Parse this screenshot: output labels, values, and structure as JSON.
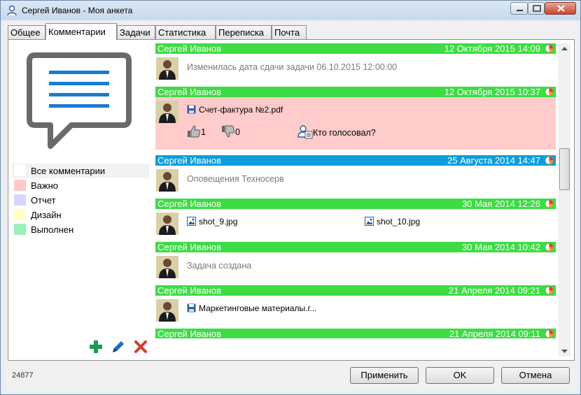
{
  "window": {
    "title": "Сергей Иванов - Моя анкета"
  },
  "tabs": [
    {
      "label": "Общее"
    },
    {
      "label": "Комментарии"
    },
    {
      "label": "Задачи"
    },
    {
      "label": "Статистика"
    },
    {
      "label": "Переписка"
    },
    {
      "label": "Почта"
    }
  ],
  "active_tab": "Комментарии",
  "filters": [
    {
      "label": "Все комментарии",
      "color": "#ffffff"
    },
    {
      "label": "Важно",
      "color": "#ffc9c9"
    },
    {
      "label": "Отчет",
      "color": "#d6d6ff"
    },
    {
      "label": "Дизайн",
      "color": "#ffffc4"
    },
    {
      "label": "Выполнен",
      "color": "#9cf0b8"
    }
  ],
  "colors": {
    "green": "#3ddc43",
    "blue": "#0d9ddb",
    "important_bg": "#ffcbcb"
  },
  "comments": [
    {
      "author": "Сергей Иванов",
      "date": "12 Октября 2015 14:09",
      "header_color": "#3ddc43",
      "bg": "#ffffff",
      "text": "Изменилась дата сдачи задачи 06.10.2015 12:00:00",
      "files": []
    },
    {
      "author": "Сергей Иванов",
      "date": "12 Октября 2015 10:37",
      "header_color": "#3ddc43",
      "bg": "#ffcbcb",
      "text": "",
      "files": [
        {
          "name": "Счет-фактура №2.pdf",
          "icon": "floppy-icon"
        }
      ],
      "likes": "1",
      "dislikes": "0",
      "who_voted": "Кто голосовал?"
    },
    {
      "author": "Сергей Иванов",
      "date": "25 Августа 2014 14:47",
      "header_color": "#0d9ddb",
      "bg": "#ffffff",
      "text": "Оповещения Техносерв",
      "files": []
    },
    {
      "author": "Сергей Иванов",
      "date": "30 Мая 2014 12:26",
      "header_color": "#3ddc43",
      "bg": "#ffffff",
      "text": "",
      "files": [
        {
          "name": "shot_9.jpg",
          "icon": "image-icon"
        },
        {
          "name": "shot_10.jpg",
          "icon": "image-icon"
        }
      ]
    },
    {
      "author": "Сергей Иванов",
      "date": "30 Мая 2014 10:42",
      "header_color": "#3ddc43",
      "bg": "#ffffff",
      "text": "Задача создана",
      "files": []
    },
    {
      "author": "Сергей Иванов",
      "date": "21 Апреля 2014 09:21",
      "header_color": "#3ddc43",
      "bg": "#ffffff",
      "text": "",
      "files": [
        {
          "name": "Маркетинговые материалы.г...",
          "icon": "floppy-icon"
        }
      ]
    },
    {
      "author": "Сергей Иванов",
      "date": "21 Апреля 2014 09:11",
      "header_color": "#3ddc43",
      "bg": "#ffffff",
      "text": "",
      "files": []
    }
  ],
  "footer": {
    "id": "24877",
    "apply": "Применить",
    "ok": "OK",
    "cancel": "Отмена"
  }
}
